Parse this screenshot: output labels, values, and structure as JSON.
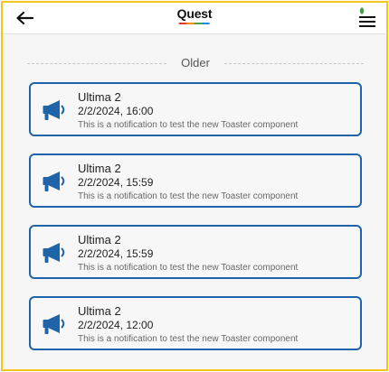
{
  "header": {
    "logo_text": "Quest",
    "logo_colors": [
      "#E53935",
      "#FB8C00",
      "#43A047",
      "#1E88E5"
    ],
    "back_icon": "arrow-left-icon",
    "menu_icon": "hamburger-menu-icon",
    "menu_indicator_color": "#43A047"
  },
  "section": {
    "label": "Older"
  },
  "accent_color": "#1f64a8",
  "notifications": [
    {
      "title": "Ultima 2",
      "time": "2/2/2024, 16:00",
      "message": "This is a notification to test the new Toaster component",
      "icon": "megaphone-icon"
    },
    {
      "title": "Ultima 2",
      "time": "2/2/2024, 15:59",
      "message": "This is a notification to test the new Toaster component",
      "icon": "megaphone-icon"
    },
    {
      "title": "Ultima 2",
      "time": "2/2/2024, 15:59",
      "message": "This is a notification to test the new Toaster component",
      "icon": "megaphone-icon"
    },
    {
      "title": "Ultima 2",
      "time": "2/2/2024, 12:00",
      "message": "This is a notification to test the new Toaster component",
      "icon": "megaphone-icon"
    }
  ]
}
